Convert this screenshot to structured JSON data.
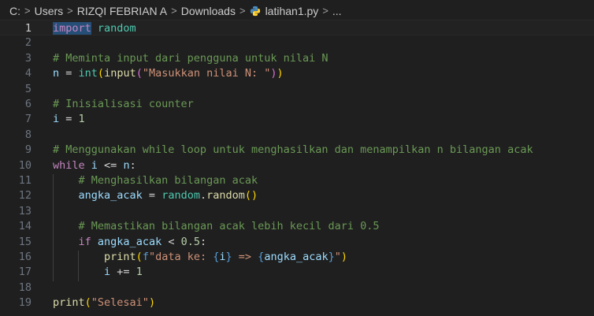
{
  "breadcrumb": {
    "drive": "C:",
    "users": "Users",
    "user": "RIZQI FEBRIAN A",
    "folder": "Downloads",
    "file": "latihan1.py",
    "more": "..."
  },
  "lines": [
    {
      "n": "1",
      "tokens": [
        {
          "t": "import",
          "c": "kw"
        },
        {
          "t": " "
        },
        {
          "t": "random",
          "c": "ns"
        }
      ]
    },
    {
      "n": "2",
      "tokens": []
    },
    {
      "n": "3",
      "tokens": [
        {
          "t": "# Meminta input dari pengguna untuk nilai N",
          "c": "cmt"
        }
      ]
    },
    {
      "n": "4",
      "tokens": [
        {
          "t": "n",
          "c": "var"
        },
        {
          "t": " = "
        },
        {
          "t": "int",
          "c": "ns"
        },
        {
          "t": "(",
          "c": "br1"
        },
        {
          "t": "input",
          "c": "fn"
        },
        {
          "t": "(",
          "c": "br2"
        },
        {
          "t": "\"Masukkan nilai N: \"",
          "c": "str"
        },
        {
          "t": ")",
          "c": "br2"
        },
        {
          "t": ")",
          "c": "br1"
        }
      ]
    },
    {
      "n": "5",
      "tokens": []
    },
    {
      "n": "6",
      "tokens": [
        {
          "t": "# Inisialisasi counter",
          "c": "cmt"
        }
      ]
    },
    {
      "n": "7",
      "tokens": [
        {
          "t": "i",
          "c": "var"
        },
        {
          "t": " = "
        },
        {
          "t": "1",
          "c": "num"
        }
      ]
    },
    {
      "n": "8",
      "tokens": []
    },
    {
      "n": "9",
      "tokens": [
        {
          "t": "# Menggunakan while loop untuk menghasilkan dan menampilkan n bilangan acak",
          "c": "cmt"
        }
      ]
    },
    {
      "n": "10",
      "tokens": [
        {
          "t": "while",
          "c": "kw"
        },
        {
          "t": " "
        },
        {
          "t": "i",
          "c": "var"
        },
        {
          "t": " <= "
        },
        {
          "t": "n",
          "c": "var"
        },
        {
          "t": ":"
        }
      ]
    },
    {
      "n": "11",
      "tokens": [
        {
          "t": "    "
        },
        {
          "t": "# Menghasilkan bilangan acak",
          "c": "cmt"
        }
      ]
    },
    {
      "n": "12",
      "tokens": [
        {
          "t": "    "
        },
        {
          "t": "angka_acak",
          "c": "var"
        },
        {
          "t": " = "
        },
        {
          "t": "random",
          "c": "ns"
        },
        {
          "t": "."
        },
        {
          "t": "random",
          "c": "fn"
        },
        {
          "t": "(",
          "c": "br1"
        },
        {
          "t": ")",
          "c": "br1"
        }
      ]
    },
    {
      "n": "13",
      "tokens": []
    },
    {
      "n": "14",
      "tokens": [
        {
          "t": "    "
        },
        {
          "t": "# Memastikan bilangan acak lebih kecil dari 0.5",
          "c": "cmt"
        }
      ]
    },
    {
      "n": "15",
      "tokens": [
        {
          "t": "    "
        },
        {
          "t": "if",
          "c": "kw"
        },
        {
          "t": " "
        },
        {
          "t": "angka_acak",
          "c": "var"
        },
        {
          "t": " < "
        },
        {
          "t": "0.5",
          "c": "num"
        },
        {
          "t": ":"
        }
      ]
    },
    {
      "n": "16",
      "tokens": [
        {
          "t": "        "
        },
        {
          "t": "print",
          "c": "fn"
        },
        {
          "t": "(",
          "c": "br1"
        },
        {
          "t": "f",
          "c": "fstr"
        },
        {
          "t": "\"data ke: ",
          "c": "str"
        },
        {
          "t": "{",
          "c": "fstr"
        },
        {
          "t": "i",
          "c": "var"
        },
        {
          "t": "}",
          "c": "fstr"
        },
        {
          "t": " => ",
          "c": "str"
        },
        {
          "t": "{",
          "c": "fstr"
        },
        {
          "t": "angka_acak",
          "c": "var"
        },
        {
          "t": "}",
          "c": "fstr"
        },
        {
          "t": "\"",
          "c": "str"
        },
        {
          "t": ")",
          "c": "br1"
        }
      ]
    },
    {
      "n": "17",
      "tokens": [
        {
          "t": "        "
        },
        {
          "t": "i",
          "c": "var"
        },
        {
          "t": " += "
        },
        {
          "t": "1",
          "c": "num"
        }
      ]
    },
    {
      "n": "18",
      "tokens": []
    },
    {
      "n": "19",
      "tokens": [
        {
          "t": "print",
          "c": "fn"
        },
        {
          "t": "(",
          "c": "br1"
        },
        {
          "t": "\"Selesai\"",
          "c": "str"
        },
        {
          "t": ")",
          "c": "br1"
        }
      ]
    }
  ],
  "current_line": "1",
  "icons": {
    "sep": "chevron-right-icon",
    "file": "python-file-icon"
  }
}
